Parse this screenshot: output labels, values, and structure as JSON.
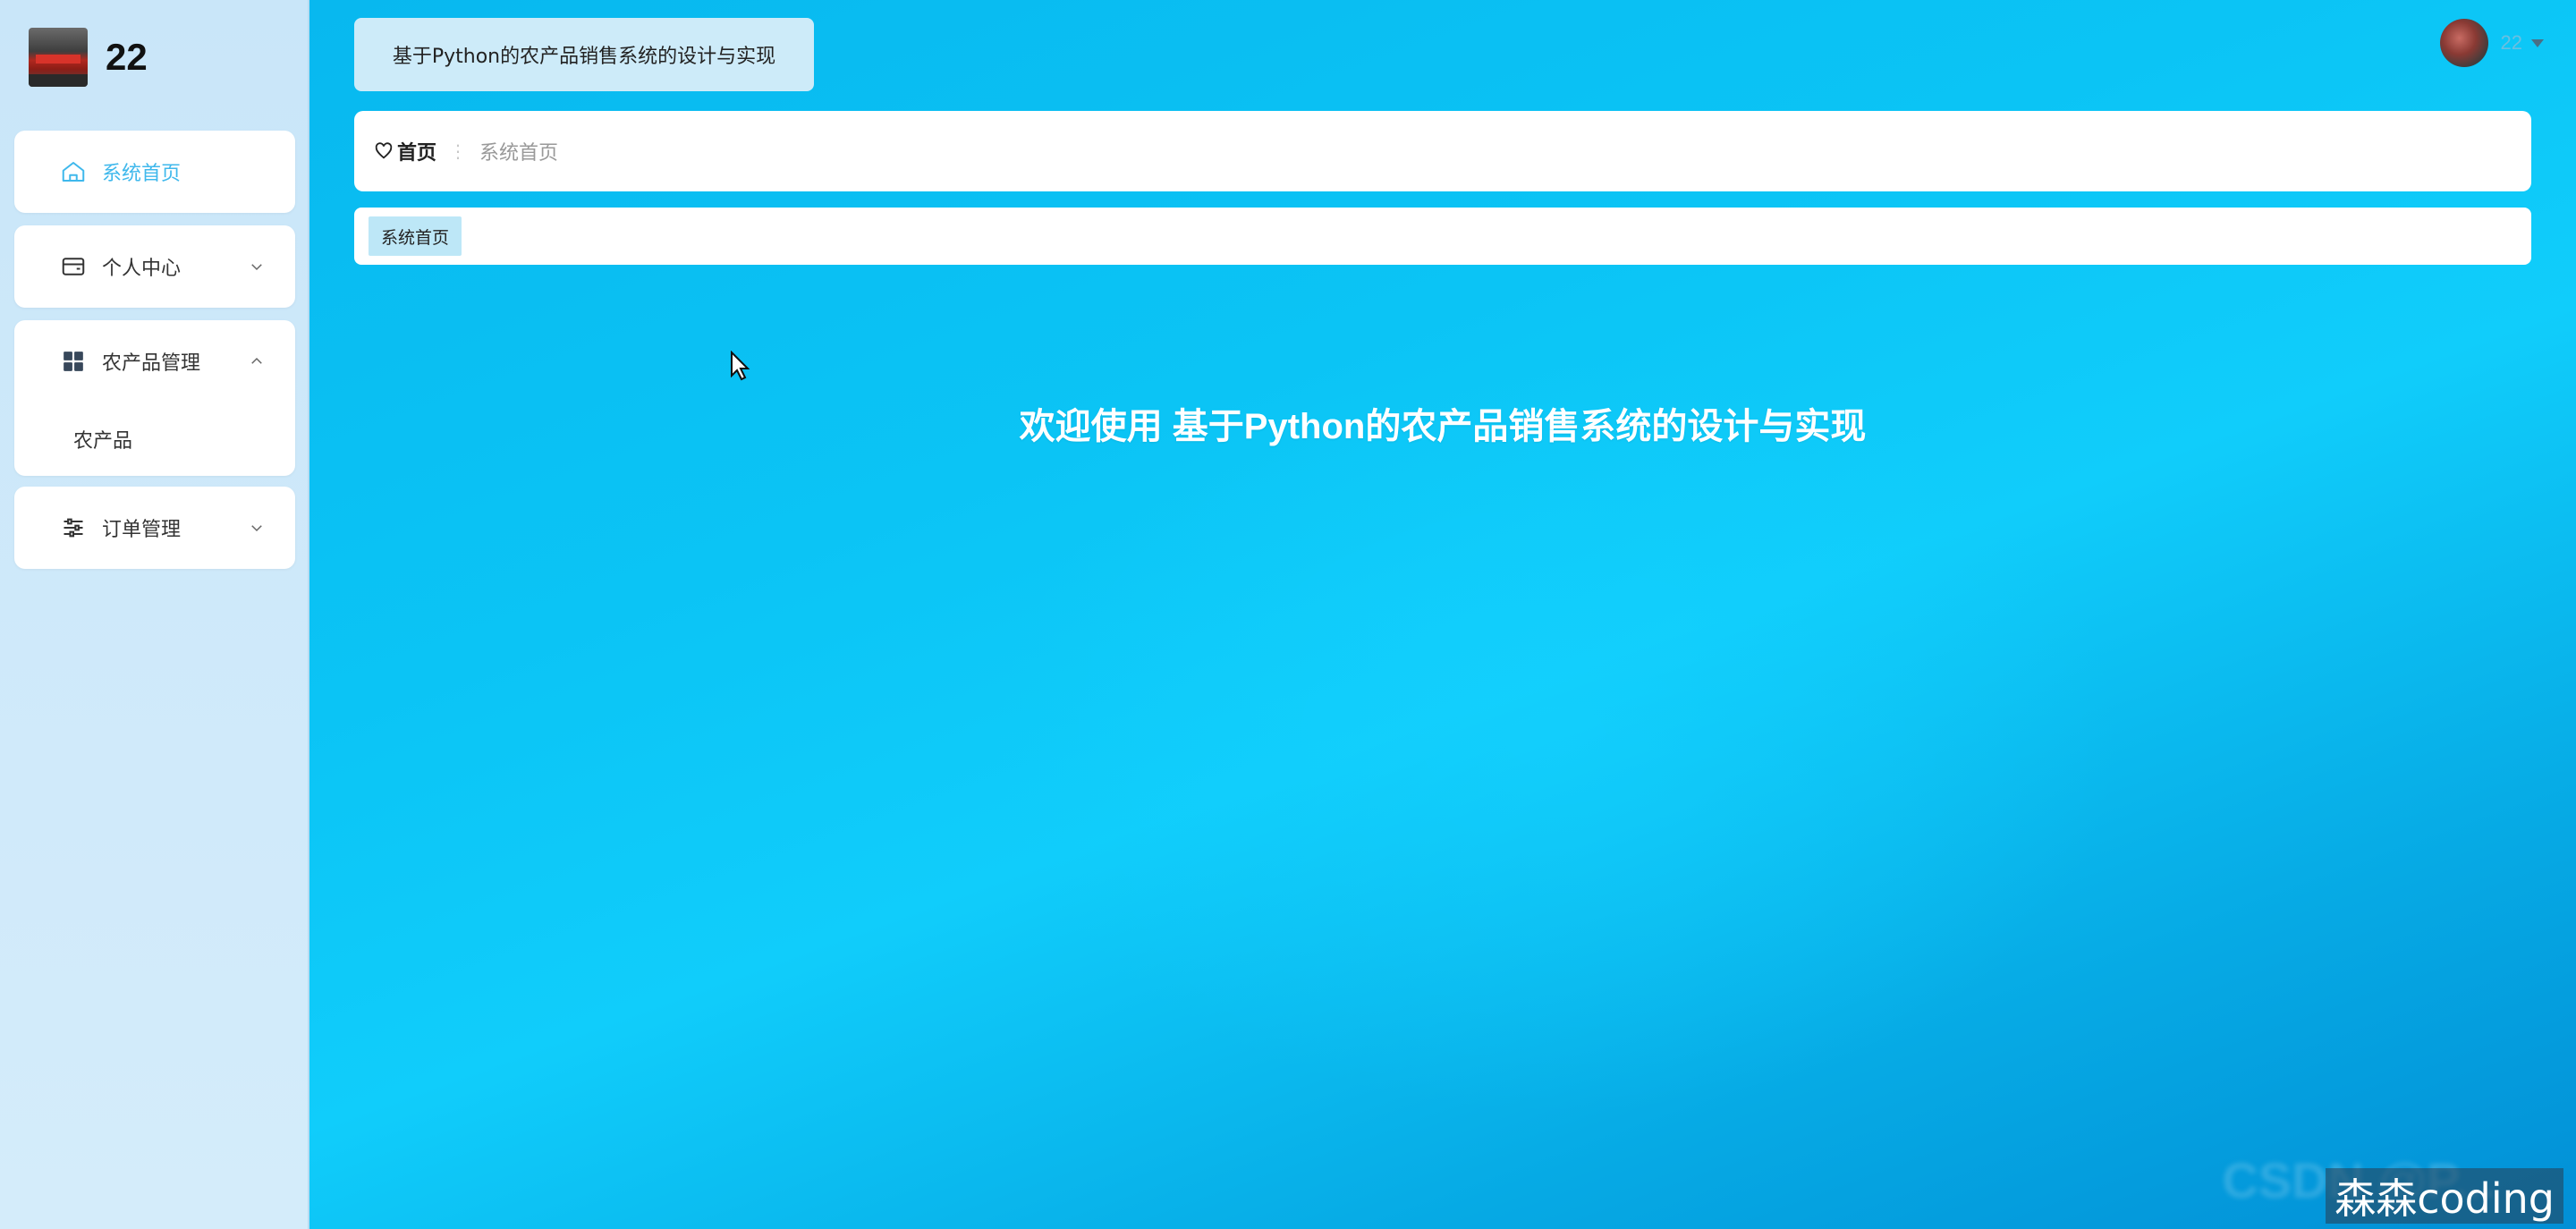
{
  "brand": {
    "name": "22"
  },
  "sidebar": {
    "items": [
      {
        "label": "系统首页",
        "icon": "home-icon",
        "active": true
      },
      {
        "label": "个人中心",
        "icon": "wallet-icon",
        "expanded": false
      },
      {
        "label": "农产品管理",
        "icon": "grid-icon",
        "expanded": true,
        "children": [
          {
            "label": "农产品"
          }
        ]
      },
      {
        "label": "订单管理",
        "icon": "sliders-icon",
        "expanded": false
      }
    ]
  },
  "header": {
    "title": "基于Python的农产品销售系统的设计与实现",
    "user": {
      "name": "22"
    }
  },
  "breadcrumb": {
    "home": "首页",
    "separator": "⋮",
    "current": "系统首页"
  },
  "tags": [
    {
      "label": "系统首页"
    }
  ],
  "main": {
    "welcome": "欢迎使用 基于Python的农产品销售系统的设计与实现"
  },
  "watermark": {
    "faint": "CSDN @P...",
    "label": "森森coding"
  },
  "colors": {
    "accent": "#3fb8ec",
    "main_bg": "#0bc4f5",
    "sidebar_bg": "#c9e6f9",
    "tag_bg": "#bde7f7"
  }
}
